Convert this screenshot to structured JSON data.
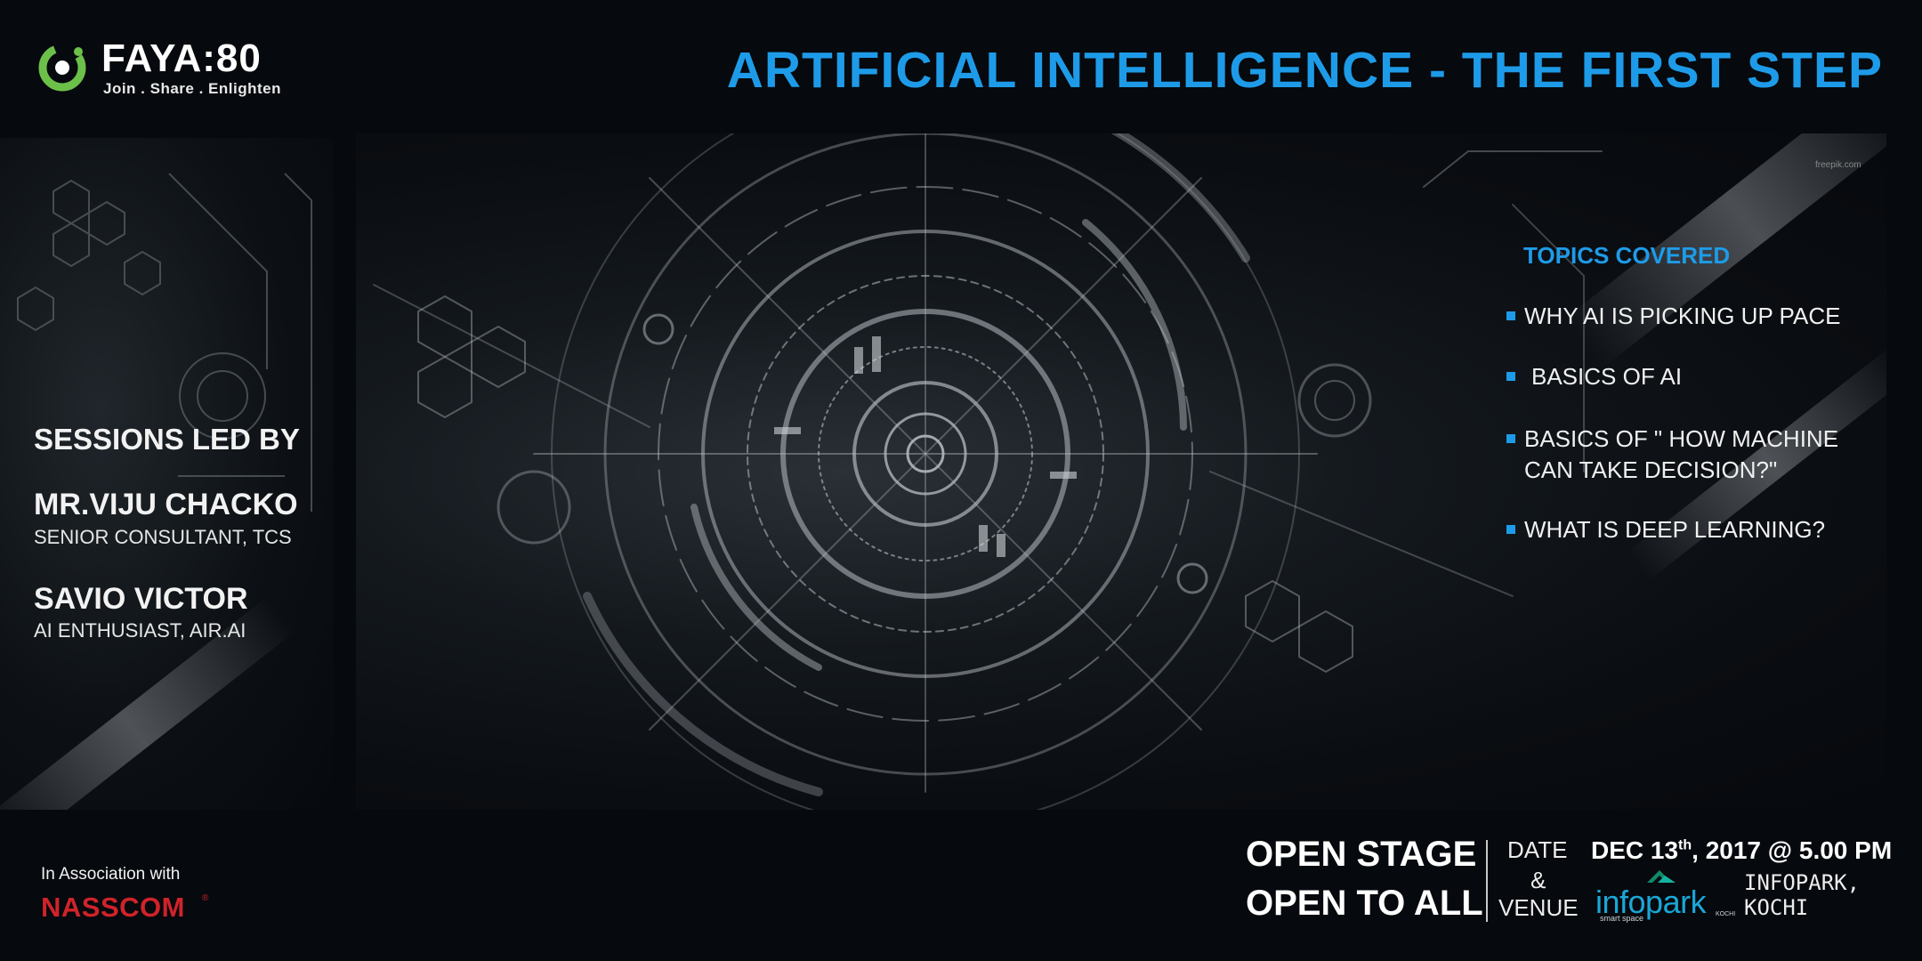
{
  "logo": {
    "wordmark": "FAYA:80",
    "tagline": "Join . Share . Enlighten",
    "colors": {
      "ring": "#6cc04a",
      "text": "#ffffff"
    }
  },
  "header": {
    "title": "ARTIFICIAL INTELLIGENCE - THE FIRST STEP"
  },
  "speakers": {
    "heading": "SESSIONS LED BY",
    "items": [
      {
        "name": "MR.VIJU CHACKO",
        "role": "SENIOR CONSULTANT, TCS"
      },
      {
        "name": "SAVIO VICTOR",
        "role": "AI ENTHUSIAST, AIR.AI"
      }
    ]
  },
  "topics": {
    "heading": "TOPICS COVERED",
    "items": [
      "WHY AI IS PICKING UP PACE",
      "BASICS OF AI",
      [
        "BASICS OF \" HOW MACHINE",
        "CAN TAKE DECISION?\""
      ],
      "WHAT IS DEEP LEARNING?"
    ]
  },
  "footer": {
    "association_label": "In Association with",
    "partner": "NASSCOM",
    "partner_mark": "®",
    "open_stage": "OPEN STAGE",
    "open_to_all": "OPEN TO ALL",
    "date_label": "DATE",
    "amp": "&",
    "venue_label": "VENUE",
    "date_day": "DEC 13",
    "date_suffix": "th",
    "date_rest": ", 2017 @ 5.00 PM",
    "venue_logo": {
      "word": "infopark",
      "sub": "smart space",
      "city_mark": "KOCHI"
    },
    "venue_line1": "INFOPARK,",
    "venue_line2": "KOCHI"
  },
  "colors": {
    "accent": "#1e9be8",
    "background": "#06090d",
    "partner_red": "#d0232a"
  }
}
